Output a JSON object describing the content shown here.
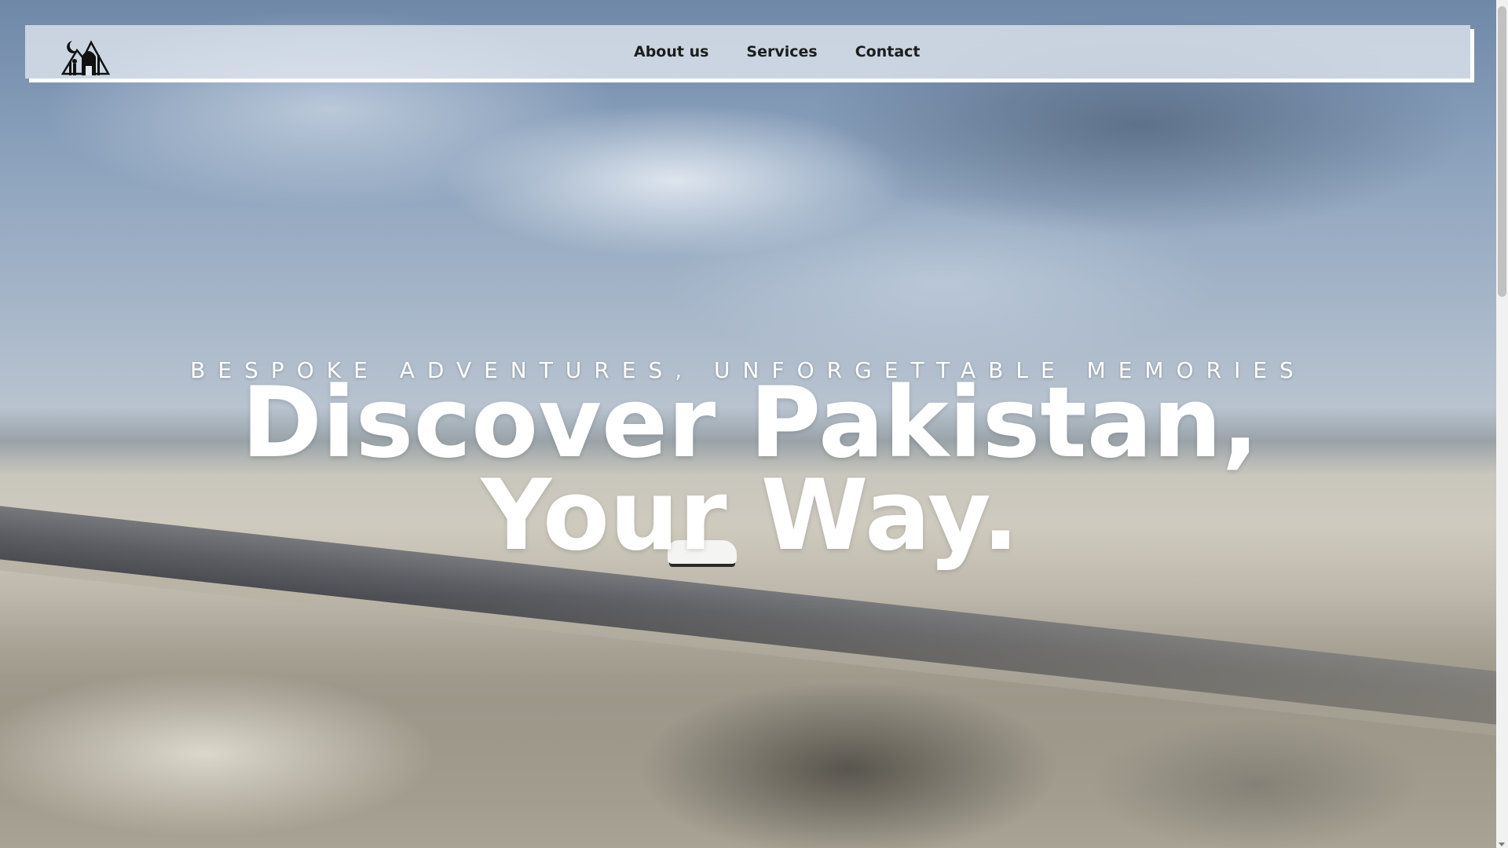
{
  "logo": {
    "icon": "mountain-mosque-logo-icon"
  },
  "nav": {
    "items": [
      {
        "label": "About us"
      },
      {
        "label": "Services"
      },
      {
        "label": "Contact"
      }
    ]
  },
  "hero": {
    "tagline": "BESPOKE ADVENTURES, UNFORGETTABLE MEMORIES",
    "headline": "Discover Pakistan, Your Way.",
    "background": "aerial-desert-road-image"
  },
  "colors": {
    "text": "#ffffff",
    "nav_text": "#1d1d1d",
    "navbar_bg": "#e1e8f0"
  }
}
